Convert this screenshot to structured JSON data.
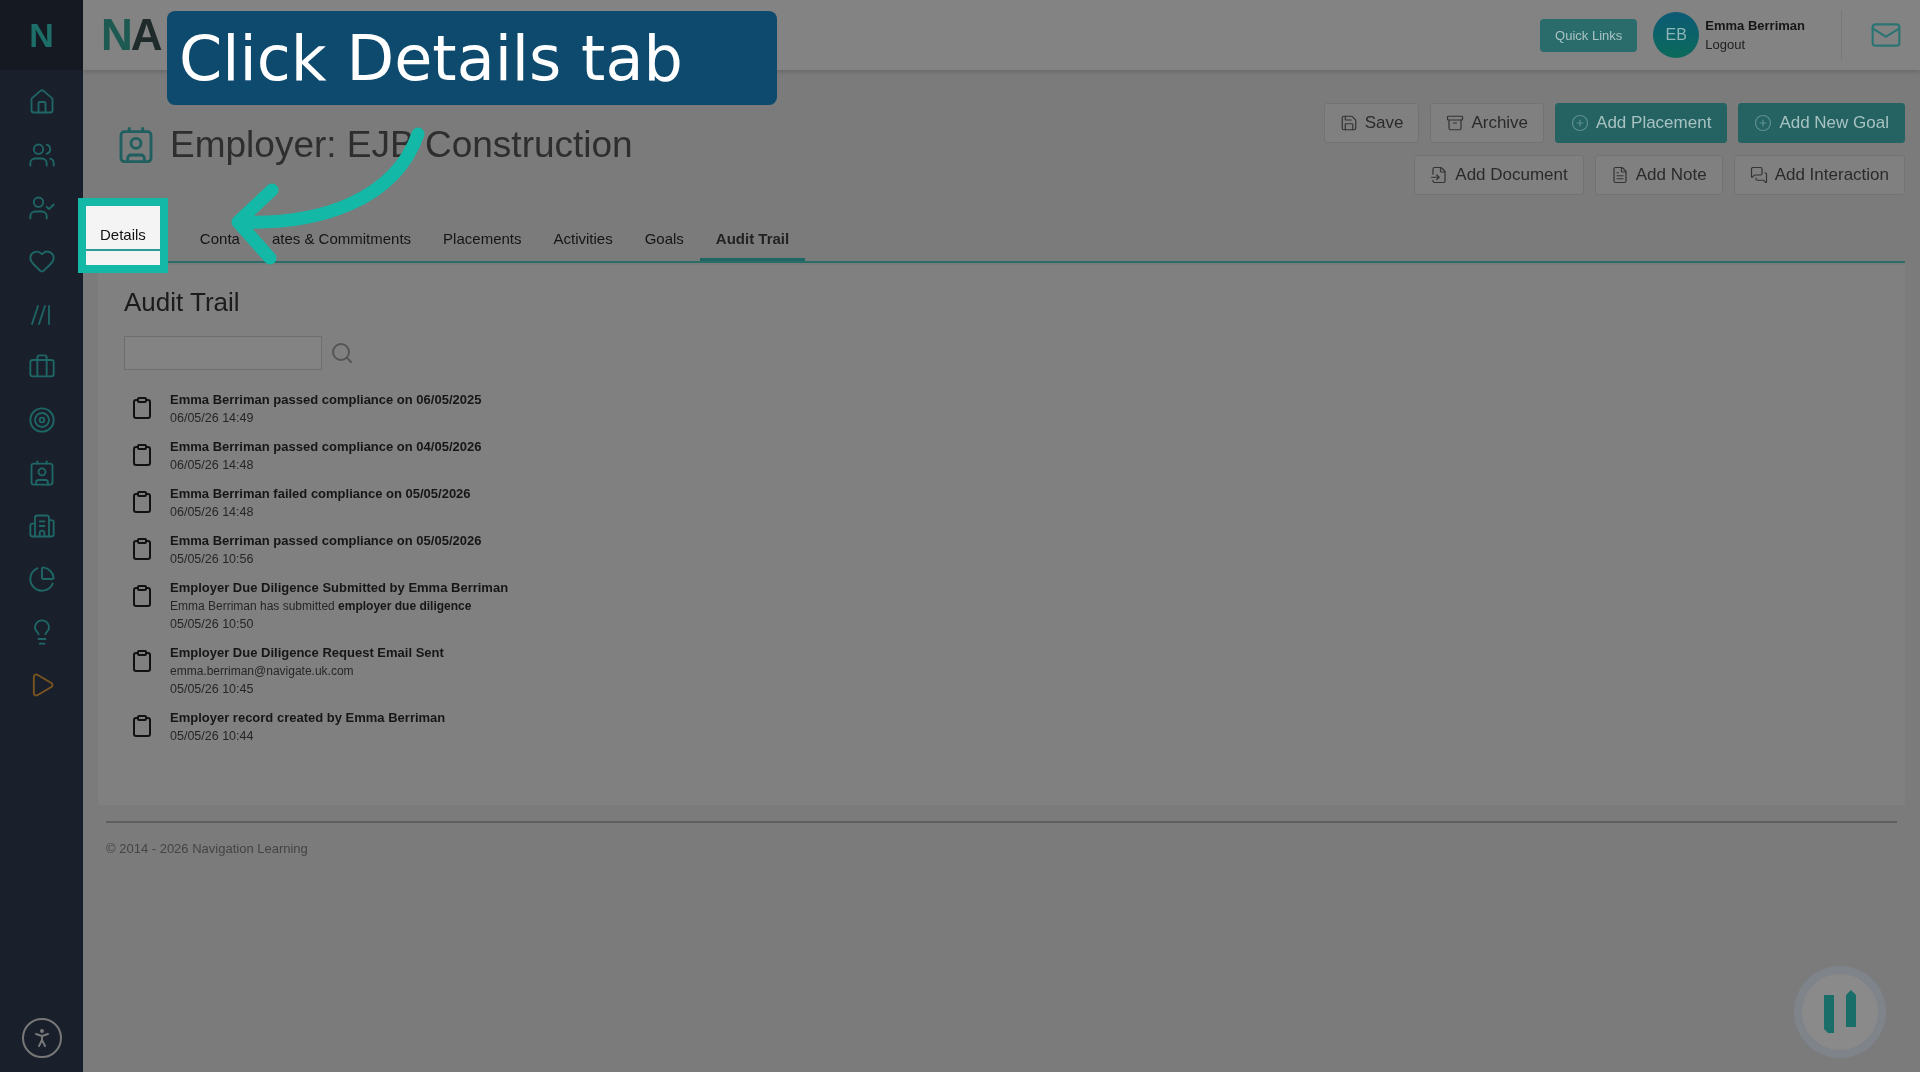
{
  "callout": {
    "text": "Click Details tab"
  },
  "sidebar": {
    "logo": "N"
  },
  "logo": {
    "first": "N",
    "rest": "A"
  },
  "top_bar": {
    "quick_links": "Quick Links",
    "user": {
      "initials": "EB",
      "name": "Emma Berriman",
      "logout": "Logout"
    }
  },
  "page": {
    "title": "Employer: EJB Construction"
  },
  "actions": [
    [
      {
        "label": "Save",
        "kind": "secondary"
      },
      {
        "label": "Archive",
        "kind": "secondary"
      },
      {
        "label": "Add Placement",
        "kind": "primary"
      },
      {
        "label": "Add New Goal",
        "kind": "primary"
      }
    ],
    [
      {
        "label": "Add Document",
        "kind": "secondary"
      },
      {
        "label": "Add Note",
        "kind": "secondary"
      },
      {
        "label": "Add Interaction",
        "kind": "secondary"
      }
    ]
  ],
  "tabs": [
    {
      "label": "Details",
      "selected": false,
      "highlighted": true
    },
    {
      "label": "Conta",
      "selected": false,
      "highlighted": false
    },
    {
      "label": "ates & Commitments",
      "selected": false,
      "highlighted": false
    },
    {
      "label": "Placements",
      "selected": false,
      "highlighted": false
    },
    {
      "label": "Activities",
      "selected": false,
      "highlighted": false
    },
    {
      "label": "Goals",
      "selected": false,
      "highlighted": false
    },
    {
      "label": "Audit Trail",
      "selected": true,
      "highlighted": false
    }
  ],
  "audit_trail": {
    "heading": "Audit Trail",
    "entries": [
      {
        "title": "Emma Berriman passed compliance on 06/05/2025",
        "time": "06/05/26 14:49"
      },
      {
        "title": "Emma Berriman passed compliance on 04/05/2026",
        "time": "06/05/26 14:48"
      },
      {
        "title": "Emma Berriman failed compliance on 05/05/2026",
        "time": "06/05/26 14:48"
      },
      {
        "title": "Emma Berriman passed compliance on 05/05/2026",
        "time": "05/05/26 10:56"
      },
      {
        "title": "Employer Due Diligence Submitted by Emma Berriman",
        "detail": "Emma Berriman has submitted **employer due diligence**",
        "time": "05/05/26 10:50"
      },
      {
        "title": "Employer Due Diligence Request Email Sent",
        "detail": "emma.berriman@navigate.uk.com",
        "time": "05/05/26 10:45"
      },
      {
        "title": "Employer record created by Emma Berriman",
        "time": "05/05/26 10:44"
      }
    ]
  },
  "footer": "© 2014 - 2026 Navigation Learning"
}
